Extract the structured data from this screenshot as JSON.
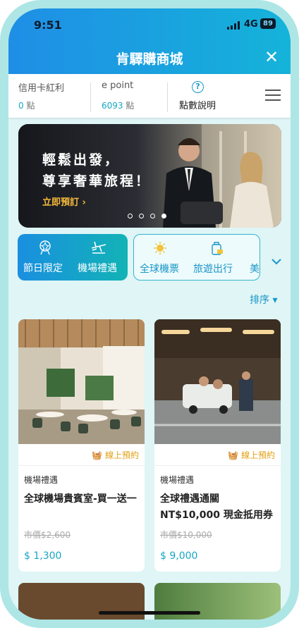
{
  "status": {
    "time": "9:51",
    "network": "4G",
    "battery": "89"
  },
  "header": {
    "title": "肯驛購商城",
    "close_glyph": "✕"
  },
  "points": {
    "credit_label": "信用卡紅利",
    "credit_value": "0",
    "credit_unit": "點",
    "epoint_label": "e point",
    "epoint_value": "6093",
    "epoint_unit": "點",
    "help_label": "點數說明"
  },
  "banner": {
    "headline_1": "輕鬆出發，",
    "headline_2": "尊享奢華旅程！",
    "cta": "立即預訂 ›",
    "slide_count": 4,
    "active_slide": 4
  },
  "categories": {
    "primary": [
      {
        "label": "節日限定",
        "icon": "gift-icon"
      },
      {
        "label": "機場禮遇",
        "icon": "plane-icon"
      }
    ],
    "secondary": [
      {
        "label": "全球機票",
        "icon": "sun-icon"
      },
      {
        "label": "旅遊出行",
        "icon": "luggage-icon"
      },
      {
        "label": "美"
      }
    ],
    "expand_icon": "chevron-down-icon"
  },
  "sort": {
    "label": "排序 ▾"
  },
  "products": [
    {
      "tag": "線上預約",
      "category": "機場禮遇",
      "title": "全球機場貴賓室-買一送一",
      "original_price": "市價$2,600",
      "price": "$ 1,300"
    },
    {
      "tag": "線上預約",
      "category": "機場禮遇",
      "title": "全球禮遇通關 NT$10,000 現金抵用券",
      "original_price": "市價$10,000",
      "price": "$ 9,000"
    }
  ],
  "colors": {
    "accent": "#1a96c8",
    "price": "#17a7c4",
    "tag": "#e3a114",
    "header_start": "#1f8ee6",
    "header_end": "#15b3d9"
  }
}
